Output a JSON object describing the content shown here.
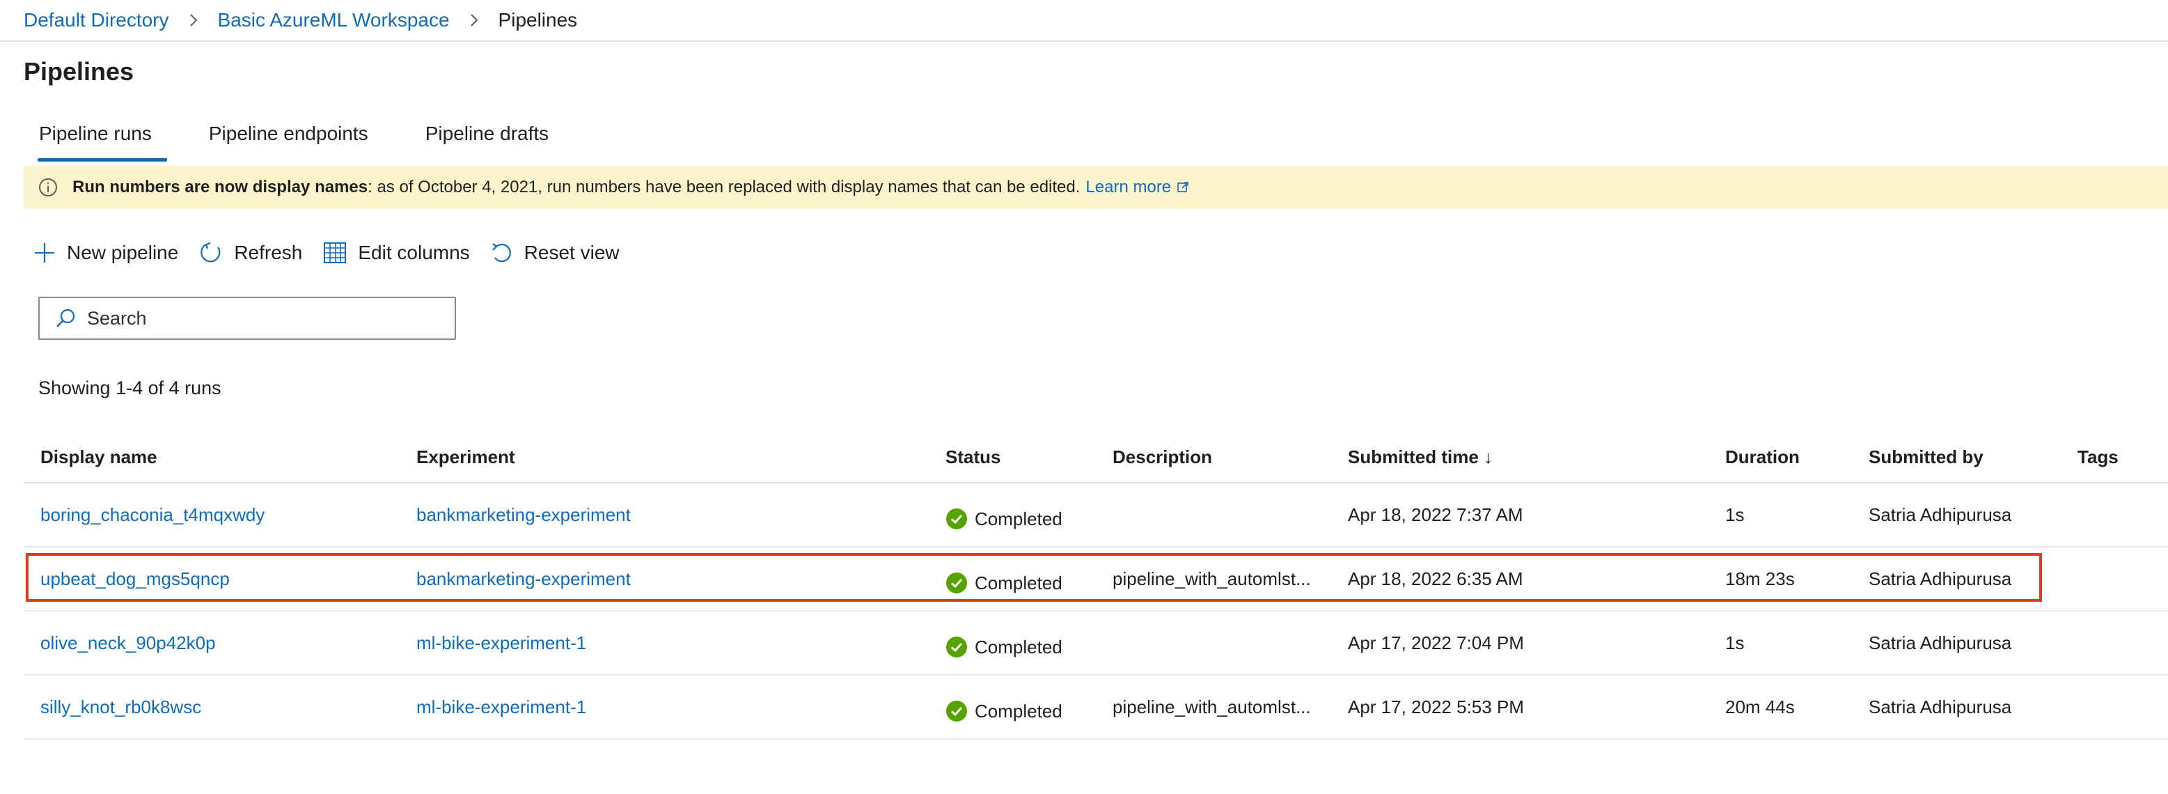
{
  "breadcrumb": {
    "items": [
      "Default Directory",
      "Basic AzureML Workspace"
    ],
    "current": "Pipelines"
  },
  "page": {
    "title": "Pipelines"
  },
  "tabs": [
    {
      "label": "Pipeline runs",
      "active": true
    },
    {
      "label": "Pipeline endpoints",
      "active": false
    },
    {
      "label": "Pipeline drafts",
      "active": false
    }
  ],
  "banner": {
    "bold": "Run numbers are now display names",
    "text": ": as of October 4, 2021, run numbers have been replaced with display names that can be edited.",
    "link": "Learn more",
    "icon": "info-icon"
  },
  "toolbar": {
    "new_pipeline": "New pipeline",
    "refresh": "Refresh",
    "edit_columns": "Edit columns",
    "reset_view": "Reset view"
  },
  "search": {
    "placeholder": "Search",
    "value": ""
  },
  "showing": "Showing 1-4 of 4 runs",
  "table": {
    "headers": [
      "Display name",
      "Experiment",
      "Status",
      "Description",
      "Submitted time ↓",
      "Duration",
      "Submitted by",
      "Tags"
    ],
    "rows": [
      {
        "name": "boring_chaconia_t4mqxwdy",
        "experiment": "bankmarketing-experiment",
        "status": "Completed",
        "description": "",
        "submitted": "Apr 18, 2022 7:37 AM",
        "duration": "1s",
        "by": "Satria Adhipurusa",
        "tags": ""
      },
      {
        "name": "upbeat_dog_mgs5qncp",
        "experiment": "bankmarketing-experiment",
        "status": "Completed",
        "description": "pipeline_with_automlst...",
        "submitted": "Apr 18, 2022 6:35 AM",
        "duration": "18m 23s",
        "by": "Satria Adhipurusa",
        "tags": ""
      },
      {
        "name": "olive_neck_90p42k0p",
        "experiment": "ml-bike-experiment-1",
        "status": "Completed",
        "description": "",
        "submitted": "Apr 17, 2022 7:04 PM",
        "duration": "1s",
        "by": "Satria Adhipurusa",
        "tags": ""
      },
      {
        "name": "silly_knot_rb0k8wsc",
        "experiment": "ml-bike-experiment-1",
        "status": "Completed",
        "description": "pipeline_with_automlst...",
        "submitted": "Apr 17, 2022 5:53 PM",
        "duration": "20m 44s",
        "by": "Satria Adhipurusa",
        "tags": ""
      }
    ]
  },
  "colors": {
    "link": "#0f6cbd",
    "banner_bg": "#fcf4cb",
    "success": "#57a300",
    "highlight": "#e03c17"
  }
}
